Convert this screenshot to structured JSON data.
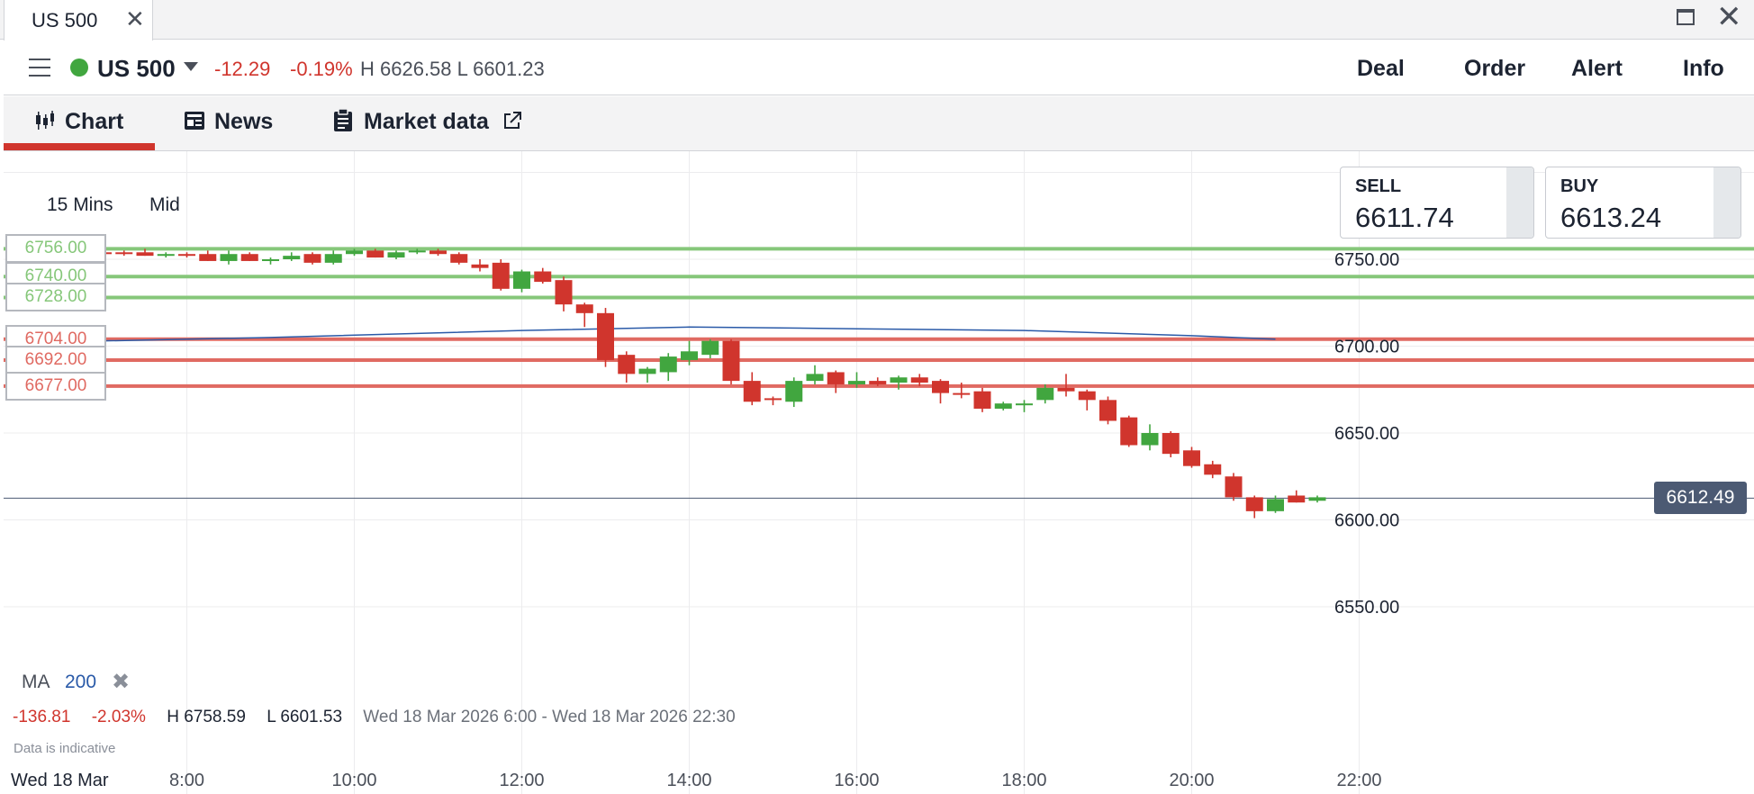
{
  "window": {
    "tab_title": "US 500"
  },
  "instrument": {
    "name": "US 500",
    "status_color": "#41a63f",
    "change_abs": "-12.29",
    "change_pct": "-0.19%",
    "high_low": "H 6626.58  L 6601.23"
  },
  "header_actions": [
    "Deal",
    "Order",
    "Alert",
    "Info"
  ],
  "tabs": [
    {
      "label": "Chart",
      "icon": "candlestick-chart-icon",
      "active": true
    },
    {
      "label": "News",
      "icon": "newspaper-icon"
    },
    {
      "label": "Market data",
      "icon": "clipboard-icon",
      "external": "external-link-icon"
    }
  ],
  "chart": {
    "timeframe": "15 Mins",
    "price_type": "Mid",
    "sell_label": "SELL",
    "sell": "6611.74",
    "buy_label": "BUY",
    "buy": "6613.24",
    "current_price": "6612.49",
    "indicator": {
      "name": "MA",
      "value": "200"
    },
    "stats": {
      "change_abs": "-136.81",
      "change_pct": "-2.03%",
      "high": "H 6758.59",
      "low": "L 6601.53",
      "range": "Wed 18 Mar 2026 6:00 - Wed 18 Mar 2026 22:30"
    },
    "disclaimer": "Data is indicative",
    "date_label": "Wed 18 Mar"
  },
  "colors": {
    "up": "#41a63f",
    "down": "#d0352d",
    "ma_line": "#2a5aa8",
    "support_line": "#86c77a",
    "resistance_line": "#e06a62",
    "current_line": "#4c5a73"
  },
  "chart_data": {
    "type": "candlestick",
    "x_ticks": [
      "8:00",
      "10:00",
      "12:00",
      "14:00",
      "16:00",
      "18:00",
      "20:00",
      "22:00"
    ],
    "y_ticks": [
      "6750.00",
      "6700.00",
      "6650.00",
      "6600.00",
      "6550.00"
    ],
    "ylim": [
      6542,
      6810
    ],
    "grid": true,
    "levels": [
      {
        "label": "6756.00",
        "value": 6756,
        "kind": "support"
      },
      {
        "label": "6740.00",
        "value": 6740,
        "kind": "support"
      },
      {
        "label": "6728.00",
        "value": 6728,
        "kind": "support"
      },
      {
        "label": "6704.00",
        "value": 6704,
        "kind": "resistance"
      },
      {
        "label": "6692.00",
        "value": 6692,
        "kind": "resistance"
      },
      {
        "label": "6677.00",
        "value": 6677,
        "kind": "resistance"
      }
    ],
    "current": 6612.49,
    "ma200": [
      {
        "t": "6:00",
        "v": 6702
      },
      {
        "t": "9:00",
        "v": 6705
      },
      {
        "t": "12:00",
        "v": 6709
      },
      {
        "t": "14:00",
        "v": 6711
      },
      {
        "t": "16:00",
        "v": 6710
      },
      {
        "t": "18:00",
        "v": 6709
      },
      {
        "t": "20:00",
        "v": 6706
      },
      {
        "t": "21:00",
        "v": 6704
      }
    ],
    "candles": [
      {
        "t": "6:00",
        "o": 6754,
        "h": 6756,
        "l": 6751,
        "c": 6752
      },
      {
        "t": "6:15",
        "o": 6753,
        "h": 6755,
        "l": 6751,
        "c": 6754
      },
      {
        "t": "6:30",
        "o": 6754,
        "h": 6756,
        "l": 6752,
        "c": 6755
      },
      {
        "t": "6:45",
        "o": 6755,
        "h": 6756,
        "l": 6752,
        "c": 6753
      },
      {
        "t": "7:00",
        "o": 6754,
        "h": 6756,
        "l": 6752,
        "c": 6753
      },
      {
        "t": "7:15",
        "o": 6754,
        "h": 6755,
        "l": 6752,
        "c": 6753
      },
      {
        "t": "7:30",
        "o": 6754,
        "h": 6756,
        "l": 6752,
        "c": 6752
      },
      {
        "t": "7:45",
        "o": 6752,
        "h": 6754,
        "l": 6751,
        "c": 6753
      },
      {
        "t": "8:00",
        "o": 6753,
        "h": 6754,
        "l": 6751,
        "c": 6752
      },
      {
        "t": "8:15",
        "o": 6753,
        "h": 6755,
        "l": 6749,
        "c": 6749
      },
      {
        "t": "8:30",
        "o": 6749,
        "h": 6755,
        "l": 6747,
        "c": 6753
      },
      {
        "t": "8:45",
        "o": 6753,
        "h": 6754,
        "l": 6749,
        "c": 6749
      },
      {
        "t": "9:00",
        "o": 6750,
        "h": 6751,
        "l": 6747,
        "c": 6750
      },
      {
        "t": "9:15",
        "o": 6750,
        "h": 6754,
        "l": 6749,
        "c": 6752
      },
      {
        "t": "9:30",
        "o": 6753,
        "h": 6754,
        "l": 6747,
        "c": 6748
      },
      {
        "t": "9:45",
        "o": 6748,
        "h": 6755,
        "l": 6747,
        "c": 6753
      },
      {
        "t": "10:00",
        "o": 6753,
        "h": 6756,
        "l": 6752,
        "c": 6755
      },
      {
        "t": "10:15",
        "o": 6755,
        "h": 6756,
        "l": 6751,
        "c": 6751
      },
      {
        "t": "10:30",
        "o": 6751,
        "h": 6755,
        "l": 6750,
        "c": 6754
      },
      {
        "t": "10:45",
        "o": 6754,
        "h": 6756,
        "l": 6753,
        "c": 6755
      },
      {
        "t": "11:00",
        "o": 6755,
        "h": 6756,
        "l": 6752,
        "c": 6753
      },
      {
        "t": "11:15",
        "o": 6753,
        "h": 6754,
        "l": 6747,
        "c": 6748
      },
      {
        "t": "11:30",
        "o": 6747,
        "h": 6750,
        "l": 6743,
        "c": 6745
      },
      {
        "t": "11:45",
        "o": 6748,
        "h": 6750,
        "l": 6732,
        "c": 6733
      },
      {
        "t": "12:00",
        "o": 6733,
        "h": 6744,
        "l": 6731,
        "c": 6743
      },
      {
        "t": "12:15",
        "o": 6743,
        "h": 6745,
        "l": 6736,
        "c": 6737
      },
      {
        "t": "12:30",
        "o": 6738,
        "h": 6740,
        "l": 6720,
        "c": 6724
      },
      {
        "t": "12:45",
        "o": 6724,
        "h": 6725,
        "l": 6711,
        "c": 6719
      },
      {
        "t": "13:00",
        "o": 6719,
        "h": 6722,
        "l": 6688,
        "c": 6692
      },
      {
        "t": "13:15",
        "o": 6695,
        "h": 6697,
        "l": 6679,
        "c": 6684
      },
      {
        "t": "13:30",
        "o": 6684,
        "h": 6688,
        "l": 6679,
        "c": 6687
      },
      {
        "t": "13:45",
        "o": 6685,
        "h": 6696,
        "l": 6680,
        "c": 6694
      },
      {
        "t": "14:00",
        "o": 6692,
        "h": 6703,
        "l": 6689,
        "c": 6697
      },
      {
        "t": "14:15",
        "o": 6695,
        "h": 6704,
        "l": 6693,
        "c": 6703
      },
      {
        "t": "14:30",
        "o": 6703,
        "h": 6704,
        "l": 6678,
        "c": 6680
      },
      {
        "t": "14:45",
        "o": 6680,
        "h": 6685,
        "l": 6666,
        "c": 6668
      },
      {
        "t": "15:00",
        "o": 6670,
        "h": 6671,
        "l": 6666,
        "c": 6669
      },
      {
        "t": "15:15",
        "o": 6668,
        "h": 6682,
        "l": 6665,
        "c": 6680
      },
      {
        "t": "15:30",
        "o": 6680,
        "h": 6689,
        "l": 6678,
        "c": 6684
      },
      {
        "t": "15:45",
        "o": 6685,
        "h": 6686,
        "l": 6673,
        "c": 6678
      },
      {
        "t": "16:00",
        "o": 6678,
        "h": 6685,
        "l": 6676,
        "c": 6680
      },
      {
        "t": "16:15",
        "o": 6680,
        "h": 6682,
        "l": 6677,
        "c": 6678
      },
      {
        "t": "16:30",
        "o": 6679,
        "h": 6683,
        "l": 6675,
        "c": 6682
      },
      {
        "t": "16:45",
        "o": 6682,
        "h": 6684,
        "l": 6677,
        "c": 6679
      },
      {
        "t": "17:00",
        "o": 6680,
        "h": 6681,
        "l": 6667,
        "c": 6673
      },
      {
        "t": "17:15",
        "o": 6673,
        "h": 6679,
        "l": 6670,
        "c": 6672
      },
      {
        "t": "17:30",
        "o": 6674,
        "h": 6676,
        "l": 6662,
        "c": 6664
      },
      {
        "t": "17:45",
        "o": 6664,
        "h": 6668,
        "l": 6663,
        "c": 6667
      },
      {
        "t": "18:00",
        "o": 6667,
        "h": 6669,
        "l": 6662,
        "c": 6667
      },
      {
        "t": "18:15",
        "o": 6669,
        "h": 6678,
        "l": 6667,
        "c": 6676
      },
      {
        "t": "18:30",
        "o": 6676,
        "h": 6684,
        "l": 6671,
        "c": 6674
      },
      {
        "t": "18:45",
        "o": 6674,
        "h": 6675,
        "l": 6663,
        "c": 6669
      },
      {
        "t": "19:00",
        "o": 6669,
        "h": 6671,
        "l": 6655,
        "c": 6657
      },
      {
        "t": "19:15",
        "o": 6659,
        "h": 6660,
        "l": 6642,
        "c": 6643
      },
      {
        "t": "19:30",
        "o": 6643,
        "h": 6655,
        "l": 6640,
        "c": 6650
      },
      {
        "t": "19:45",
        "o": 6650,
        "h": 6651,
        "l": 6636,
        "c": 6638
      },
      {
        "t": "20:00",
        "o": 6640,
        "h": 6642,
        "l": 6630,
        "c": 6631
      },
      {
        "t": "20:15",
        "o": 6632,
        "h": 6634,
        "l": 6624,
        "c": 6626
      },
      {
        "t": "20:30",
        "o": 6625,
        "h": 6627,
        "l": 6611,
        "c": 6613
      },
      {
        "t": "20:45",
        "o": 6613,
        "h": 6614,
        "l": 6601,
        "c": 6605
      },
      {
        "t": "21:00",
        "o": 6605,
        "h": 6614,
        "l": 6604,
        "c": 6612
      },
      {
        "t": "21:15",
        "o": 6614,
        "h": 6617,
        "l": 6610,
        "c": 6610
      },
      {
        "t": "21:30",
        "o": 6611,
        "h": 6614,
        "l": 6610,
        "c": 6613
      }
    ]
  }
}
